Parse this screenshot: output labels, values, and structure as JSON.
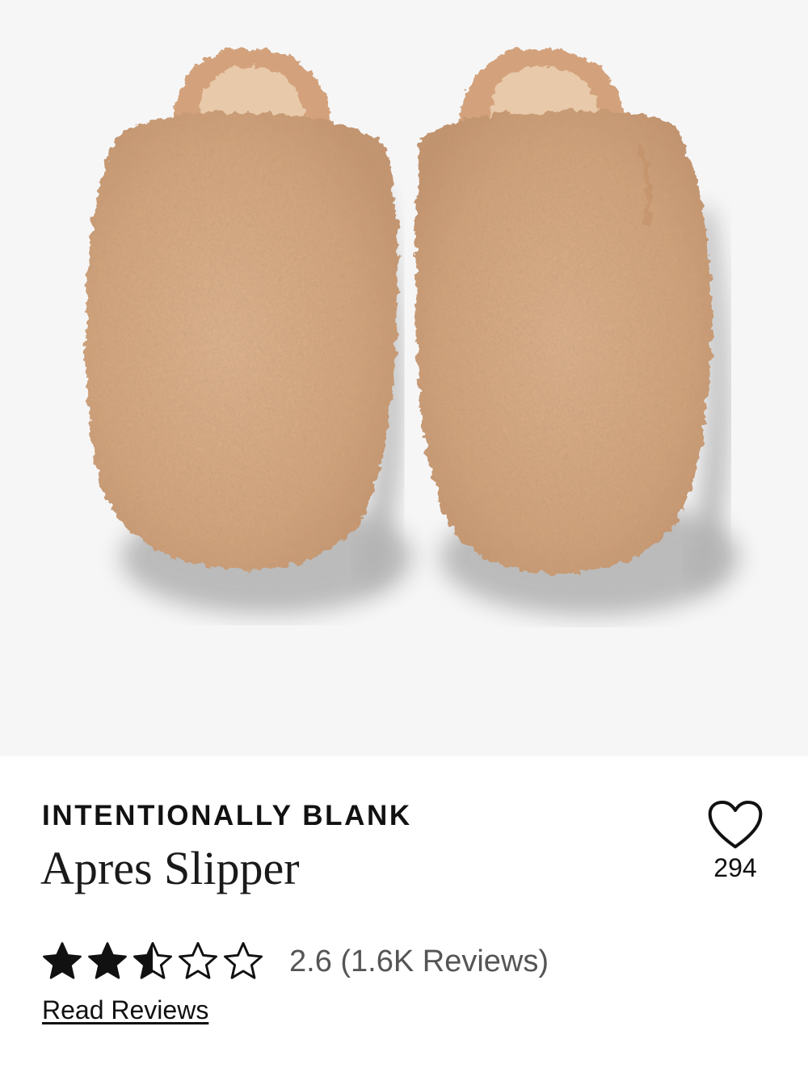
{
  "product": {
    "brand": "INTENTIONALLY BLANK",
    "name": "Apres Slipper",
    "image_alt": "product-image-slippers"
  },
  "favorite": {
    "icon": "heart-icon",
    "count": "294"
  },
  "rating": {
    "value": 2.6,
    "max": 5,
    "text": "2.6 (1.6K Reviews)",
    "stars": [
      "full",
      "full",
      "half",
      "empty",
      "empty"
    ],
    "star_icons": [
      "star-full-icon",
      "star-full-icon",
      "star-half-icon",
      "star-empty-icon",
      "star-empty-icon"
    ]
  },
  "links": {
    "read_reviews": "Read Reviews"
  },
  "colors": {
    "image_background": "#f6f6f7",
    "slipper_fur": "#d9a982",
    "star": "#111111",
    "rating_text": "#555555"
  }
}
